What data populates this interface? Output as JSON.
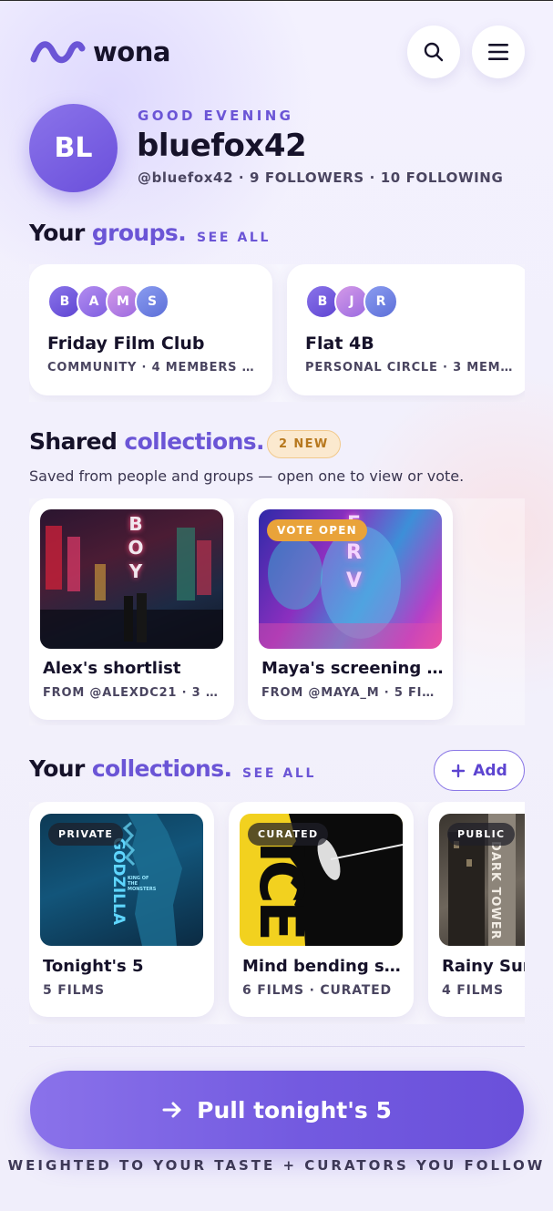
{
  "header": {
    "logo_text": "wona",
    "search_icon": "search-icon",
    "menu_icon": "hamburger-menu-icon",
    "brand_color": "#6b55d6"
  },
  "profile": {
    "initials": "BL",
    "greeting": "GOOD EVENING",
    "username": "bluefox42",
    "stats": "@bluefox42 · 9 FOLLOWERS · 10 FOLLOWING"
  },
  "groups": {
    "title_plain": "Your",
    "title_accent": "groups.",
    "see_all": "SEE ALL",
    "items": [
      {
        "name": "Friday Film Club",
        "meta": "COMMUNITY · 4 MEMBERS · 1…",
        "members": [
          "B",
          "A",
          "M",
          "S"
        ]
      },
      {
        "name": "Flat 4B",
        "meta": "PERSONAL CIRCLE · 3 MEMBE…",
        "members": [
          "B",
          "J",
          "R"
        ]
      }
    ]
  },
  "shared": {
    "title_plain": "Shared",
    "title_accent": "collections.",
    "badge": "2 NEW",
    "subtitle": "Saved from people and groups — open one to view or vote.",
    "items": [
      {
        "title": "Alex's shortlist",
        "meta": "FROM @ALEXDC21 · 3 F…",
        "poster_text": "BOY",
        "badge": ""
      },
      {
        "title": "Maya's screening r…",
        "meta": "FROM @MAYA_M · 5 FI…",
        "poster_text": "ERV",
        "badge": "VOTE OPEN"
      }
    ]
  },
  "yours": {
    "title_plain": "Your",
    "title_accent": "collections.",
    "see_all": "SEE ALL",
    "add_label": "Add",
    "items": [
      {
        "tag": "PRIVATE",
        "title": "Tonight's 5",
        "meta": "5 FILMS",
        "poster_text": "GODZILLA",
        "poster_sub": "KING OF THE MONSTERS"
      },
      {
        "tag": "CURATED",
        "title": "Mind bending sci…",
        "meta": "6 FILMS · CURATED",
        "poster_text": "ICE"
      },
      {
        "tag": "PUBLIC",
        "title": "Rainy Sun",
        "meta": "4 FILMS",
        "poster_text": "DARK TOWER"
      }
    ]
  },
  "cta": {
    "label": "Pull tonight's 5",
    "icon": "arrow-right-icon",
    "footnote": "WEIGHTED TO YOUR TASTE + CURATORS YOU FOLLOW"
  }
}
